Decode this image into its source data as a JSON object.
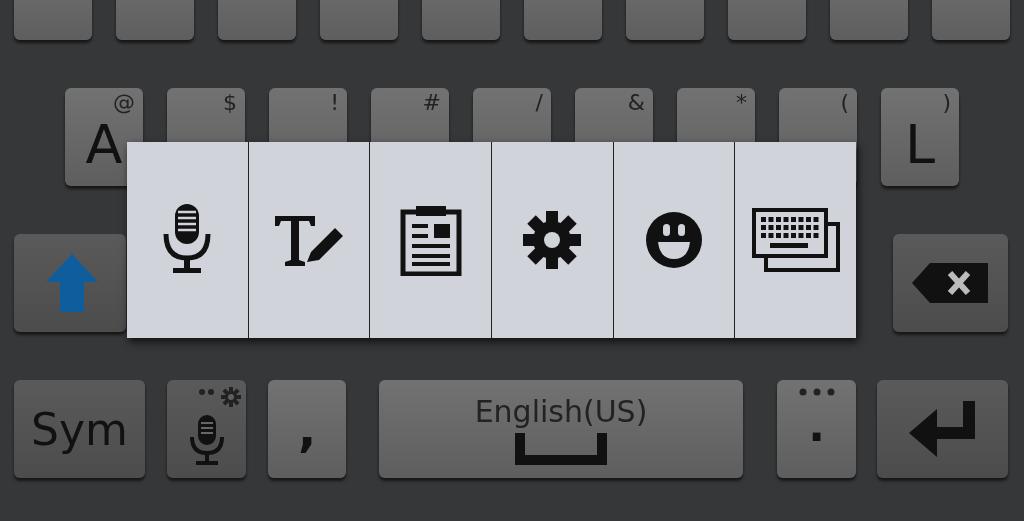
{
  "middle_row": [
    {
      "label": "A",
      "hint": "@"
    },
    {
      "hint": "$"
    },
    {
      "hint": "!"
    },
    {
      "hint": "#"
    },
    {
      "hint": "/"
    },
    {
      "hint": "&"
    },
    {
      "hint": "*"
    },
    {
      "hint": "("
    },
    {
      "label": "L",
      "hint": ")"
    }
  ],
  "bottom_row": [
    {
      "kind": "sym",
      "label": "Sym"
    },
    {
      "kind": "voice"
    },
    {
      "kind": "char",
      "label": ","
    },
    {
      "kind": "space",
      "label": "English(US)"
    },
    {
      "kind": "period",
      "label": "."
    },
    {
      "kind": "enter"
    }
  ],
  "popup": [
    {
      "kind": "voice"
    },
    {
      "kind": "handwriting"
    },
    {
      "kind": "clipboard"
    },
    {
      "kind": "settings"
    },
    {
      "kind": "emoji"
    },
    {
      "kind": "keyboard"
    }
  ]
}
